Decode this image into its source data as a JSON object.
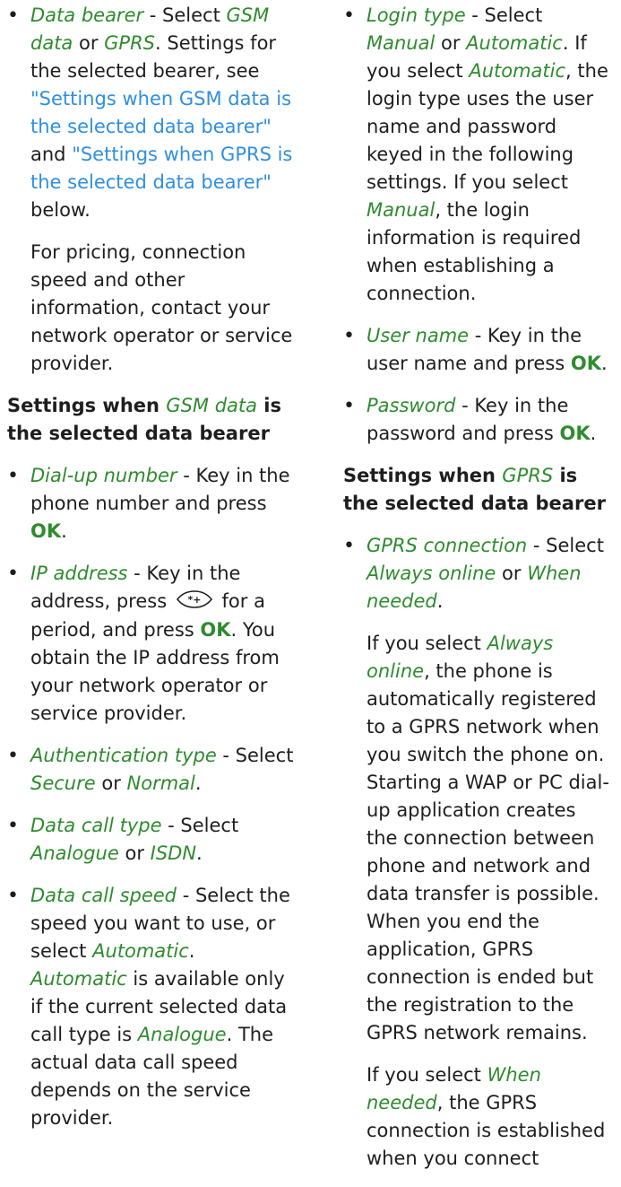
{
  "left": {
    "data_bearer": {
      "term": "Data bearer",
      "t1": " - Select ",
      "opt_gsm": "GSM data",
      "t2": " or ",
      "opt_gprs": "GPRS",
      "t3": ". Settings for the selected bearer, see ",
      "link_gsm": "\"Settings when GSM data is the selected data bearer\"",
      "t4": " and ",
      "link_gprs": "\"Settings when GPRS is the selected data bearer\"",
      "t5": " below.",
      "note": "For pricing, connection speed and other information, contact your network operator or service provider."
    },
    "heading_gsm": {
      "pre": "Settings when ",
      "opt": "GSM data",
      "post": " is the selected data bearer"
    },
    "dial_up": {
      "term": "Dial-up number",
      "t1": " - Key in the phone number and press ",
      "key": "OK",
      "t2": "."
    },
    "ip_address": {
      "term": "IP address",
      "t1": " - Key in the address, press ",
      "icon": "star-key-icon",
      "t2": " for a period, and press ",
      "key": "OK",
      "t3": ". You obtain the IP address from your network operator or service provider."
    },
    "auth_type": {
      "term": "Authentication type",
      "t1": " - Select ",
      "opt1": "Secure",
      "t2": " or ",
      "opt2": "Normal",
      "t3": "."
    },
    "call_type": {
      "term": "Data call type",
      "t1": " - Select ",
      "opt1": "Analogue",
      "t2": " or ",
      "opt2": "ISDN",
      "t3": "."
    },
    "call_speed": {
      "term": "Data call speed",
      "t1": " - Select the speed you want to use, or select ",
      "opt1": "Automatic",
      "t2": ". ",
      "opt2": "Automatic",
      "t3": " is available only if the current selected data call type is ",
      "opt3": "Analogue",
      "t4": ". The actual data call speed depends on the service provider."
    }
  },
  "right": {
    "login_type": {
      "term": "Login type",
      "t1": " - Select ",
      "opt1": "Manual",
      "t2": " or ",
      "opt2": "Automatic",
      "t3": ". If you select ",
      "opt3": "Automatic",
      "t4": ", the login type uses the user name and password keyed in the following settings. If you select ",
      "opt4": "Manual",
      "t5": ", the login information is required when establishing a connection."
    },
    "user_name": {
      "term": "User name",
      "t1": " - Key in the user name and press ",
      "key": "OK",
      "t2": "."
    },
    "password": {
      "term": "Password",
      "t1": " - Key in the password and press ",
      "key": "OK",
      "t2": "."
    },
    "heading_gprs": {
      "pre": "Settings when ",
      "opt": "GPRS",
      "post": " is the selected data bearer"
    },
    "gprs_conn": {
      "term": "GPRS connection",
      "t1": " - Select ",
      "opt1": "Always online",
      "t2": " or ",
      "opt2": "When needed",
      "t3": ".",
      "p1_pre": "If you select ",
      "p1_opt": "Always online",
      "p1_post": ", the phone is automatically registered to a GPRS network when you switch the phone on. Starting a WAP or PC dial-up application creates the connection between phone and network and data transfer is possible. When you end the application, GPRS connection is ended but the registration to the GPRS network remains.",
      "p2_pre": "If you select ",
      "p2_opt": "When needed",
      "p2_post": ", the GPRS connection is established when you connect"
    }
  },
  "colors": {
    "term": "#2e8b2e",
    "link": "#2f8fe0",
    "text": "#1e1e1e"
  }
}
